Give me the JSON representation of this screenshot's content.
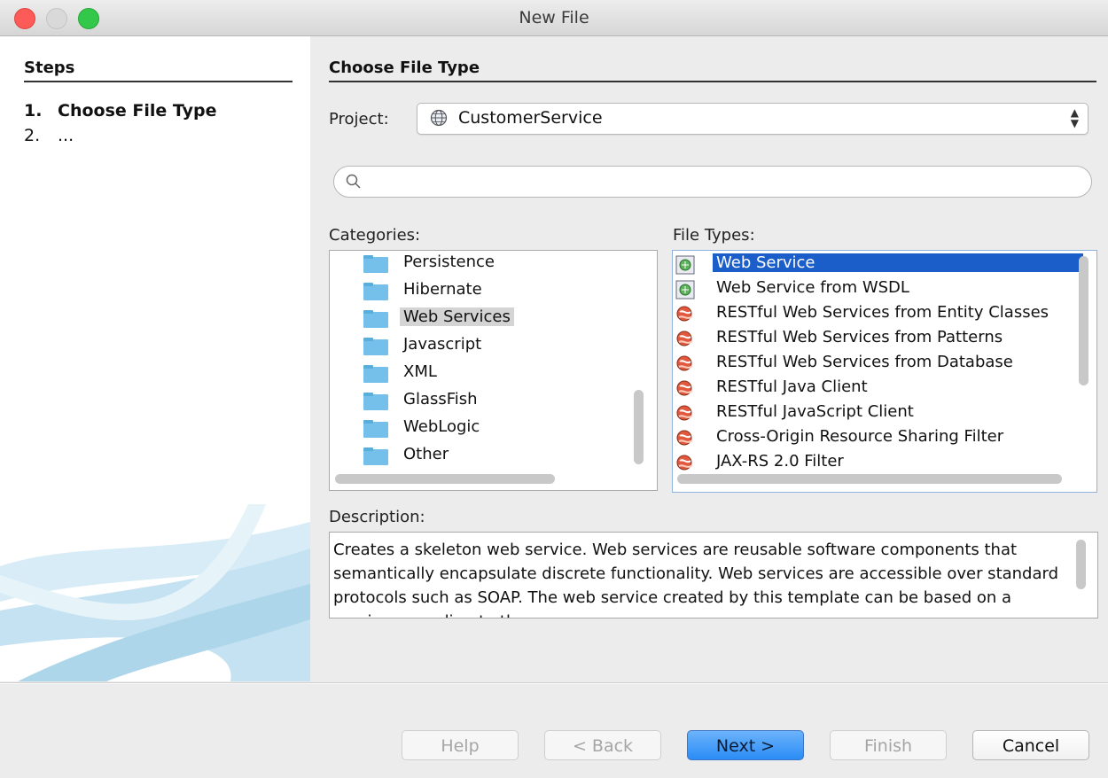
{
  "window": {
    "title": "New File"
  },
  "steps": {
    "heading": "Steps",
    "items": [
      {
        "num": "1.",
        "label": "Choose File Type"
      },
      {
        "num": "2.",
        "label": "..."
      }
    ]
  },
  "main": {
    "heading": "Choose File Type",
    "project_label": "Project:",
    "project_value": "CustomerService",
    "search": {
      "value": "",
      "placeholder": ""
    },
    "categories_label": "Categories:",
    "categories": [
      {
        "label": "Persistence"
      },
      {
        "label": "Hibernate"
      },
      {
        "label": "Web Services",
        "selected": true
      },
      {
        "label": "Javascript"
      },
      {
        "label": "XML"
      },
      {
        "label": "GlassFish"
      },
      {
        "label": "WebLogic"
      },
      {
        "label": "Other"
      }
    ],
    "file_types_label": "File Types:",
    "file_types": [
      {
        "label": "Web Service",
        "icon": "web-service-icon",
        "selected": true
      },
      {
        "label": "Web Service from WSDL",
        "icon": "web-service-icon"
      },
      {
        "label": "RESTful Web Services from Entity Classes",
        "icon": "restful-icon"
      },
      {
        "label": "RESTful Web Services from Patterns",
        "icon": "restful-icon"
      },
      {
        "label": "RESTful Web Services from Database",
        "icon": "restful-icon"
      },
      {
        "label": "RESTful Java Client",
        "icon": "restful-icon"
      },
      {
        "label": "RESTful JavaScript Client",
        "icon": "restful-icon"
      },
      {
        "label": "Cross-Origin Resource Sharing Filter",
        "icon": "restful-icon"
      },
      {
        "label": "JAX-RS 2.0 Filter",
        "icon": "restful-icon"
      }
    ],
    "description_label": "Description:",
    "description": "Creates a skeleton web service. Web services are reusable software components that semantically encapsulate discrete functionality. Web services are accessible over standard protocols such as SOAP. The web service created by this template can be based on a service according to the"
  },
  "buttons": {
    "help": "Help",
    "back": "< Back",
    "next": "Next >",
    "finish": "Finish",
    "cancel": "Cancel"
  },
  "colors": {
    "selection": "#1b5dc9",
    "default_button": "#2a8cf6",
    "close": "#fc5b57",
    "maximize": "#34c84a"
  }
}
